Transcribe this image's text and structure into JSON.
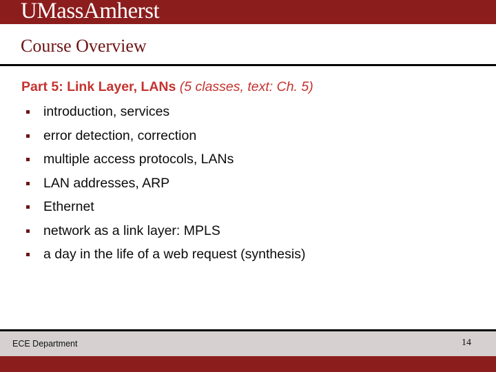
{
  "brand": {
    "logo_text": "UMassAmherst",
    "banner_color": "#8c1d1d"
  },
  "title": {
    "text": "Course Overview",
    "color": "#6e1414",
    "rule_color": "#000000"
  },
  "body": {
    "part_heading": {
      "main": "Part 5: Link Layer, LANs",
      "sub": "(5 classes, text: Ch. 5)",
      "color": "#c4332f"
    },
    "bullets": [
      {
        "text": "introduction, services"
      },
      {
        "text": "error detection, correction"
      },
      {
        "text": "multiple access protocols, LANs"
      },
      {
        "text": "LAN addresses, ARP"
      },
      {
        "text": "Ethernet"
      },
      {
        "text": "network as a link layer: MPLS"
      },
      {
        "text": "a day in the life of a web request (synthesis)"
      }
    ],
    "bullet_marker_color": "#6e1414"
  },
  "footer": {
    "department": "ECE Department",
    "page_number": "14",
    "band_color": "#d6d0d0",
    "accent_color": "#8c1d1d"
  }
}
